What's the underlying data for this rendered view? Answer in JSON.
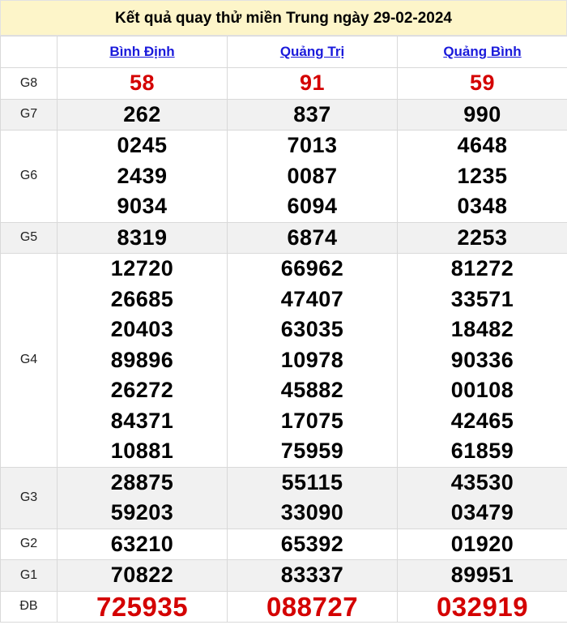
{
  "title": "Kết quả quay thử miền Trung ngày 29-02-2024",
  "provinces": [
    "Bình Định",
    "Quảng Trị",
    "Quảng Bình"
  ],
  "prizes": [
    {
      "label": "G8",
      "red": true,
      "big": false,
      "shaded": false,
      "values": [
        [
          "58"
        ],
        [
          "91"
        ],
        [
          "59"
        ]
      ]
    },
    {
      "label": "G7",
      "red": false,
      "big": false,
      "shaded": true,
      "values": [
        [
          "262"
        ],
        [
          "837"
        ],
        [
          "990"
        ]
      ]
    },
    {
      "label": "G6",
      "red": false,
      "big": false,
      "shaded": false,
      "values": [
        [
          "0245",
          "2439",
          "9034"
        ],
        [
          "7013",
          "0087",
          "6094"
        ],
        [
          "4648",
          "1235",
          "0348"
        ]
      ]
    },
    {
      "label": "G5",
      "red": false,
      "big": false,
      "shaded": true,
      "values": [
        [
          "8319"
        ],
        [
          "6874"
        ],
        [
          "2253"
        ]
      ]
    },
    {
      "label": "G4",
      "red": false,
      "big": false,
      "shaded": false,
      "values": [
        [
          "12720",
          "26685",
          "20403",
          "89896",
          "26272",
          "84371",
          "10881"
        ],
        [
          "66962",
          "47407",
          "63035",
          "10978",
          "45882",
          "17075",
          "75959"
        ],
        [
          "81272",
          "33571",
          "18482",
          "90336",
          "00108",
          "42465",
          "61859"
        ]
      ]
    },
    {
      "label": "G3",
      "red": false,
      "big": false,
      "shaded": true,
      "values": [
        [
          "28875",
          "59203"
        ],
        [
          "55115",
          "33090"
        ],
        [
          "43530",
          "03479"
        ]
      ]
    },
    {
      "label": "G2",
      "red": false,
      "big": false,
      "shaded": false,
      "values": [
        [
          "63210"
        ],
        [
          "65392"
        ],
        [
          "01920"
        ]
      ]
    },
    {
      "label": "G1",
      "red": false,
      "big": false,
      "shaded": true,
      "values": [
        [
          "70822"
        ],
        [
          "83337"
        ],
        [
          "89951"
        ]
      ]
    },
    {
      "label": "ĐB",
      "red": true,
      "big": true,
      "shaded": false,
      "values": [
        [
          "725935"
        ],
        [
          "088727"
        ],
        [
          "032919"
        ]
      ]
    }
  ]
}
